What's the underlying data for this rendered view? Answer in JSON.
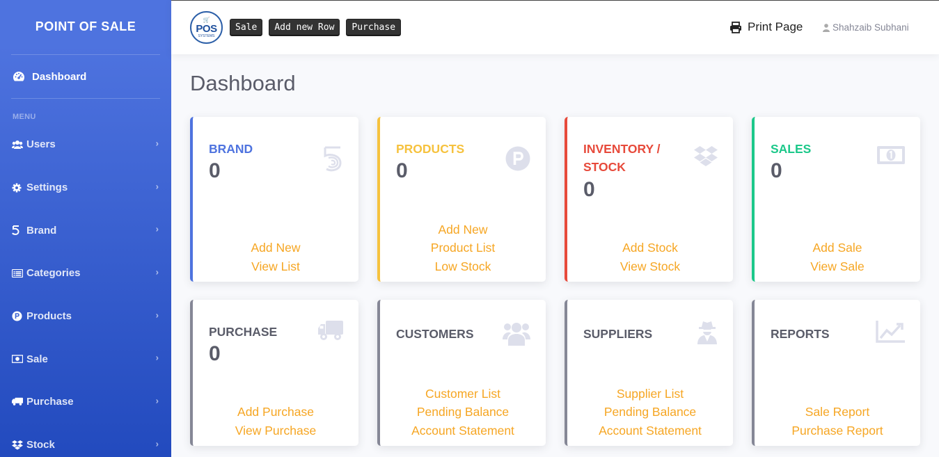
{
  "sidebar": {
    "title": "POINT OF SALE",
    "dashboard_label": "Dashboard",
    "menu_heading": "MENU",
    "items": [
      {
        "label": "Users",
        "icon": "users-icon"
      },
      {
        "label": "Settings",
        "icon": "cog-icon"
      },
      {
        "label": "Brand",
        "icon": "brand-icon"
      },
      {
        "label": "Categories",
        "icon": "list-icon"
      },
      {
        "label": "Products",
        "icon": "product-p-icon"
      },
      {
        "label": "Sale",
        "icon": "money-bill-icon"
      },
      {
        "label": "Purchase",
        "icon": "truck-icon"
      },
      {
        "label": "Stock",
        "icon": "dropbox-icon"
      }
    ],
    "chevron": "›"
  },
  "topbar": {
    "logo_text": "POS",
    "logo_subtext": "SYSTEMS",
    "shortcuts": [
      "Sale",
      "Add new Row",
      "Purchase"
    ],
    "print_label": "Print Page",
    "user_name": "Shahzaib Subhani"
  },
  "page_title": "Dashboard",
  "cards": [
    {
      "title": "BRAND",
      "count": "0",
      "color": "#4e73df",
      "icon": "brand-five-icon",
      "links": [
        "Add New",
        "View List"
      ]
    },
    {
      "title": "PRODUCTS",
      "count": "0",
      "color": "#f6c23e",
      "icon": "product-p-icon",
      "links": [
        "Add New",
        "Product List",
        "Low Stock"
      ]
    },
    {
      "title": "INVENTORY / STOCK",
      "count": "0",
      "color": "#e74a3b",
      "icon": "dropbox-icon",
      "links": [
        "Add Stock",
        "View Stock"
      ]
    },
    {
      "title": "SALES",
      "count": "0",
      "color": "#1cc88a",
      "icon": "money-bill-icon",
      "links": [
        "Add Sale",
        "View Sale"
      ]
    },
    {
      "title": "PURCHASE",
      "count": "0",
      "color": "#858796",
      "icon": "truck-icon",
      "links": [
        "Add Purchase",
        "View Purchase"
      ]
    },
    {
      "title": "CUSTOMERS",
      "count": "",
      "color": "#858796",
      "icon": "users-icon",
      "links": [
        "Customer List",
        "Pending Balance",
        "Account Statement"
      ]
    },
    {
      "title": "SUPPLIERS",
      "count": "",
      "color": "#858796",
      "icon": "user-secret-icon",
      "links": [
        "Supplier List",
        "Pending Balance",
        "Account Statement"
      ]
    },
    {
      "title": "REPORTS",
      "count": "",
      "color": "#858796",
      "icon": "chart-line-icon",
      "links": [
        "Sale Report",
        "Purchase Report"
      ]
    }
  ],
  "colors": {
    "sidebar_top": "#4e73df",
    "sidebar_bottom": "#224abe",
    "link": "#f6a623",
    "icon_faded": "#dddfeb"
  }
}
